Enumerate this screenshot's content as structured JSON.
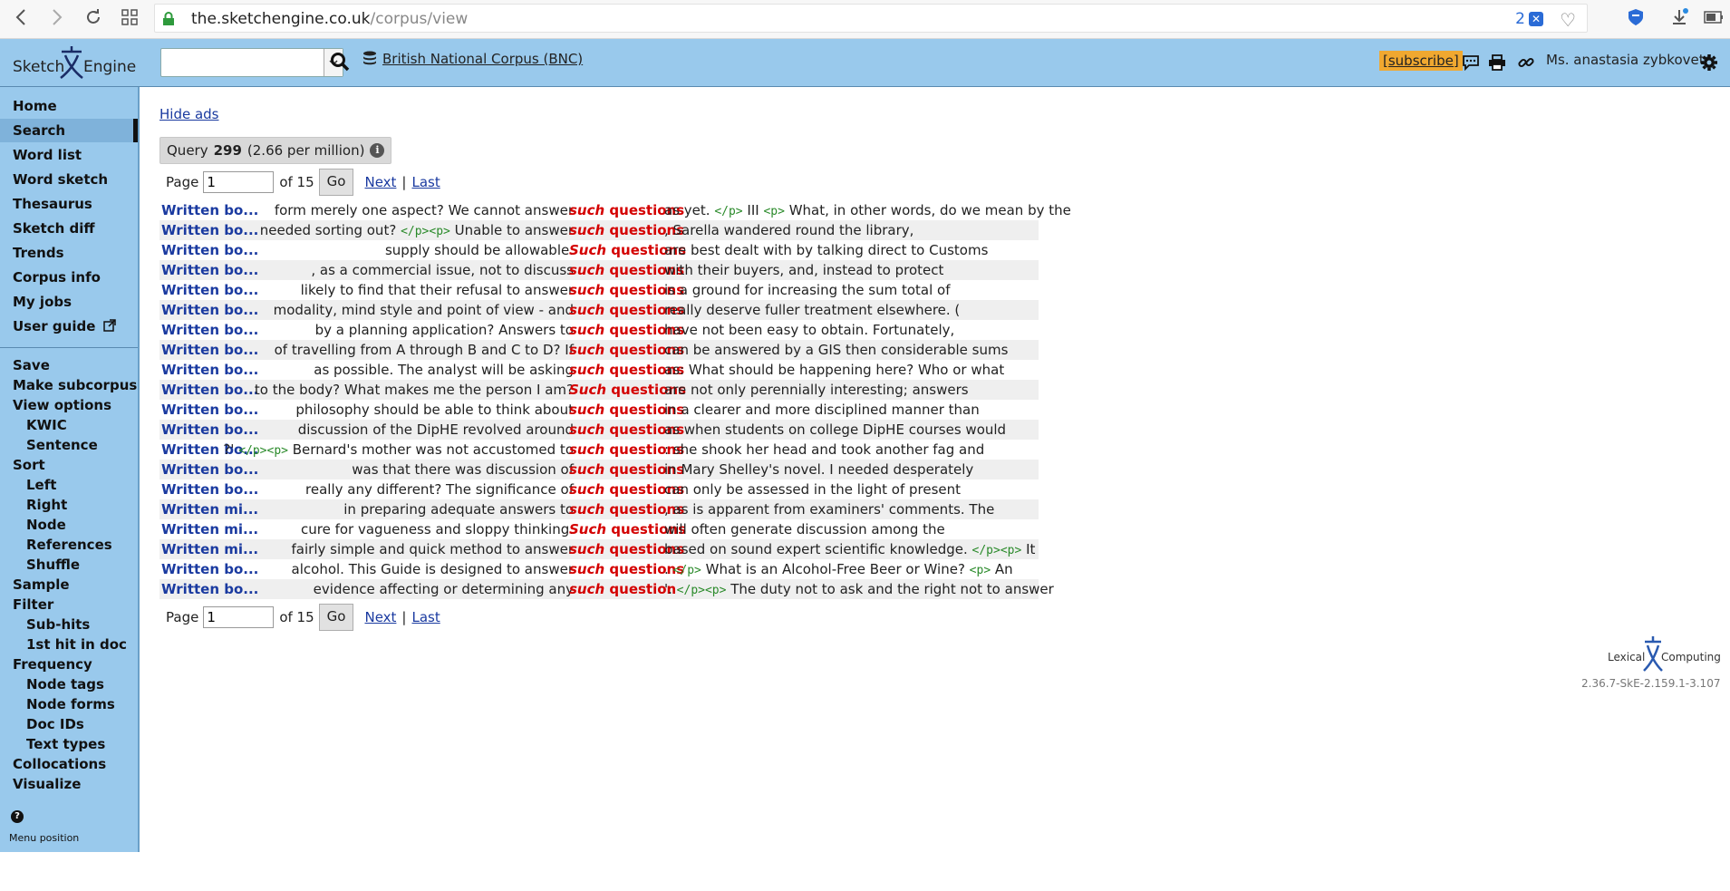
{
  "browser": {
    "url_host": "the.sketchengine.co.uk",
    "url_path": "/corpus/view",
    "tab_count": "2",
    "badge": "✕"
  },
  "header": {
    "logo_left": "Sketch",
    "logo_right": "Engine",
    "search_placeholder": "",
    "corpus_name": "British National Corpus (BNC)",
    "subscribe": "[subscribe]",
    "username": "Ms. anastasia zybkovets"
  },
  "sidebar": {
    "main": [
      "Home",
      "Search",
      "Word list",
      "Word sketch",
      "Thesaurus",
      "Sketch diff",
      "Trends",
      "Corpus info",
      "My jobs",
      "User guide"
    ],
    "active": "Search",
    "options": [
      {
        "label": "Save",
        "sub": false
      },
      {
        "label": "Make subcorpus",
        "sub": false
      },
      {
        "label": "View options",
        "sub": false
      },
      {
        "label": "KWIC",
        "sub": true
      },
      {
        "label": "Sentence",
        "sub": true
      },
      {
        "label": "Sort",
        "sub": false
      },
      {
        "label": "Left",
        "sub": true
      },
      {
        "label": "Right",
        "sub": true
      },
      {
        "label": "Node",
        "sub": true
      },
      {
        "label": "References",
        "sub": true
      },
      {
        "label": "Shuffle",
        "sub": true
      },
      {
        "label": "Sample",
        "sub": false
      },
      {
        "label": "Filter",
        "sub": false
      },
      {
        "label": "Sub-hits",
        "sub": true
      },
      {
        "label": "1st hit in doc",
        "sub": true
      },
      {
        "label": "Frequency",
        "sub": false
      },
      {
        "label": "Node tags",
        "sub": true
      },
      {
        "label": "Node forms",
        "sub": true
      },
      {
        "label": "Doc IDs",
        "sub": true
      },
      {
        "label": "Text types",
        "sub": true
      },
      {
        "label": "Collocations",
        "sub": false
      },
      {
        "label": "Visualize",
        "sub": false
      }
    ],
    "menu_position": "Menu position"
  },
  "main": {
    "hide_ads": "Hide ads",
    "query_label": "Query",
    "query_count": "299",
    "query_freq": "(2.66 per million)",
    "pager": {
      "page_label": "Page",
      "page_value": "1",
      "of_label": "of 15",
      "go": "Go",
      "next": "Next",
      "sep": "|",
      "last": "Last"
    }
  },
  "concordance": [
    {
      "ref": "Written bo...",
      "left": "form merely one aspect? We cannot answer",
      "kwic": "such questions",
      "right": "as yet. <tag></p></tag> III <tag><p></tag> What, in other words, do we mean by the"
    },
    {
      "ref": "Written bo...",
      "left": "needed sorting out? <tag></p><p></tag> Unable to answer",
      "kwic": "such questions",
      "right": ", Sarella wandered round the library,"
    },
    {
      "ref": "Written bo...",
      "left": "supply should be allowable.",
      "kwic": "Such questions",
      "right": "are best dealt with by talking direct to Customs"
    },
    {
      "ref": "Written bo...",
      "left": ", as a commercial issue, not to discuss",
      "kwic": "such questions",
      "right": "with their buyers, and, instead to protect"
    },
    {
      "ref": "Written bo...",
      "left": "likely to find that their refusal to answer",
      "kwic": "such questions",
      "right": "is a ground for increasing the sum total of"
    },
    {
      "ref": "Written bo...",
      "left": "modality, mind style and point of view - and",
      "kwic": "such questions",
      "right": "really deserve fuller treatment elsewhere. ("
    },
    {
      "ref": "Written bo...",
      "left": "by a planning application? Answers to",
      "kwic": "such questions",
      "right": "have not been easy to obtain. Fortunately,"
    },
    {
      "ref": "Written bo...",
      "left": "of travelling from A through B and C to D? If",
      "kwic": "such questions",
      "right": "can be answered by a GIS then considerable sums"
    },
    {
      "ref": "Written bo...",
      "left": "as possible. The analyst will be asking",
      "kwic": "such questions",
      "right": "as: What should be happening here? Who or what"
    },
    {
      "ref": "Written bo...",
      "left": "to the body? What makes me the person I am?",
      "kwic": "Such questions",
      "right": "are not only perennially interesting; answers"
    },
    {
      "ref": "Written bo...",
      "left": "philosophy should be able to think about",
      "kwic": "such questions",
      "right": "in a clearer and more disciplined manner than"
    },
    {
      "ref": "Written bo...",
      "left": "discussion of the DipHE revolved around",
      "kwic": "such questions",
      "right": "as when students on college DipHE courses would"
    },
    {
      "ref": "Written bo...",
      "left": "?' <tag></p><p></tag> Bernard's mother was not accustomed to",
      "kwic": "such questions",
      "right": ": she shook her head and took another fag and"
    },
    {
      "ref": "Written bo...",
      "left": "was that there was discussion of",
      "kwic": "such questions",
      "right": "in Mary Shelley's novel. I needed desperately"
    },
    {
      "ref": "Written bo...",
      "left": "really any different? The significance of",
      "kwic": "such questions",
      "right": "can only be assessed in the light of present"
    },
    {
      "ref": "Written mi...",
      "left": "in preparing adequate answers to",
      "kwic": "such questions",
      "right": ", as is apparent from examiners' comments. The"
    },
    {
      "ref": "Written mi...",
      "left": "cure for vagueness and sloppy thinking.",
      "kwic": "Such questions",
      "right": "will often generate discussion among the"
    },
    {
      "ref": "Written mi...",
      "left": "fairly simple and quick method to answer",
      "kwic": "such questions",
      "right": "based on sound expert scientific knowledge. <tag></p><p></tag> It"
    },
    {
      "ref": "Written bo...",
      "left": "alcohol. This Guide is designed to answer",
      "kwic": "such questions",
      "right": ". <tag></p></tag> What is an Alcohol-Free Beer or Wine? <tag><p></tag> An"
    },
    {
      "ref": "Written bo...",
      "left": "evidence affecting or determining any",
      "kwic": "such  question",
      "right": "'. <tag></p><p></tag> The duty not to ask and the right not to answer"
    }
  ],
  "footer": {
    "logo_left": "Lexical",
    "logo_right": "Computing",
    "version": "2.36.7-SkE-2.159.1-3.107"
  },
  "colors": {
    "header_bg": "#99c9ec",
    "kwic": "#d40000",
    "link": "#1a3aa0",
    "subscribe_bg": "#f0a830"
  }
}
